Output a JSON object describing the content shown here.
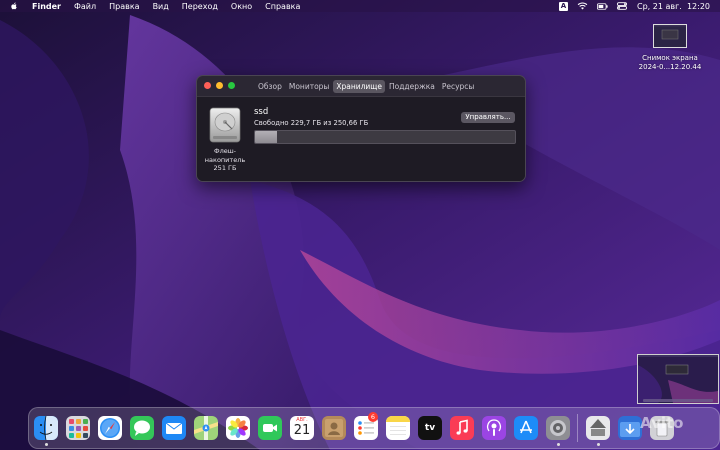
{
  "menubar": {
    "app_name": "Finder",
    "items": [
      "Файл",
      "Правка",
      "Вид",
      "Переход",
      "Окно",
      "Справка"
    ],
    "input_badge": "A",
    "clock": "Ср, 21 авг.  12:20"
  },
  "desktop_file": {
    "label_line1": "Снимок экрана",
    "label_line2": "2024-0...12.20.44"
  },
  "window": {
    "tabs": [
      "Обзор",
      "Мониторы",
      "Хранилище",
      "Поддержка",
      "Ресурсы"
    ],
    "active_tab": "Хранилище",
    "disk": {
      "caption_line1": "Флеш-",
      "caption_line2": "накопитель",
      "caption_line3": "251 ГБ",
      "volume_name": "ssd",
      "free_text": "Свободно 229,7 ГБ из 250,66 ГБ",
      "manage_button": "Управлять...",
      "used_fraction": 0.084
    }
  },
  "dock": {
    "apps": [
      {
        "name": "finder",
        "running": true
      },
      {
        "name": "launchpad",
        "running": false
      },
      {
        "name": "safari",
        "running": false
      },
      {
        "name": "messages",
        "running": false
      },
      {
        "name": "mail",
        "running": false
      },
      {
        "name": "maps",
        "running": false
      },
      {
        "name": "photos",
        "running": false
      },
      {
        "name": "facetime",
        "running": false
      },
      {
        "name": "calendar",
        "running": false
      },
      {
        "name": "contacts",
        "running": false
      },
      {
        "name": "reminders",
        "running": false
      },
      {
        "name": "notes",
        "running": false
      },
      {
        "name": "tv",
        "running": false
      },
      {
        "name": "music",
        "running": false
      },
      {
        "name": "podcasts",
        "running": false
      },
      {
        "name": "app-store",
        "running": false
      },
      {
        "name": "system-settings",
        "running": true
      },
      {
        "name": "screen-sharing",
        "running": true
      },
      {
        "name": "downloads",
        "running": false
      },
      {
        "name": "trash",
        "running": false
      }
    ],
    "calendar_month": "АВГ.",
    "calendar_day": "21",
    "reminders_badge": "6",
    "tv_label": "tv"
  },
  "watermark": "Avito",
  "colors": {
    "accent_red": "#fe5f57",
    "accent_yellow": "#febc2e",
    "accent_green": "#28c840",
    "window_bg": "#1e1b24"
  }
}
